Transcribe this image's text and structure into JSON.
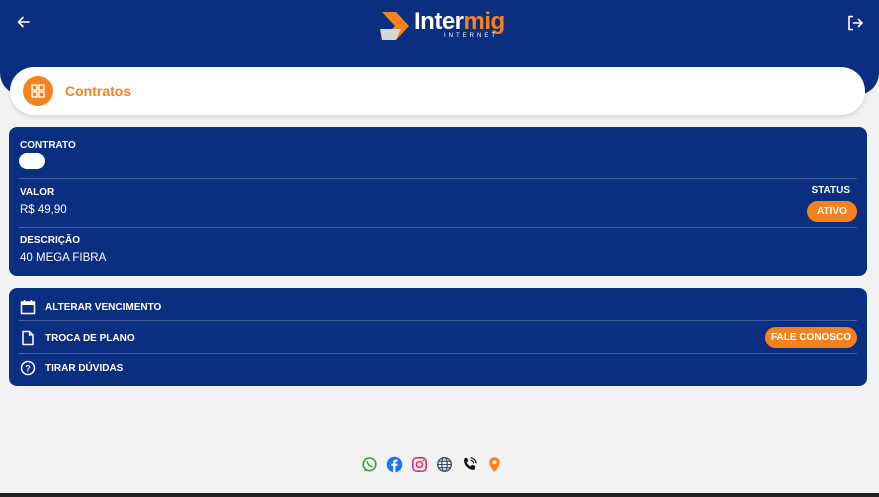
{
  "header": {
    "logo_main_white": "Inter",
    "logo_main_orange": "mig",
    "logo_sub": "INTERNET",
    "back_icon": "arrow-left-icon",
    "logout_icon": "logout-icon"
  },
  "title_card": {
    "icon": "grid-icon",
    "title": "Contratos"
  },
  "contract": {
    "contrato_label": "CONTRATO",
    "valor_label": "VALOR",
    "valor_value": "R$ 49,90",
    "status_label": "STATUS",
    "status_value": "ATIVO",
    "descricao_label": "DESCRIÇÃO",
    "descricao_value": "40 MEGA FIBRA"
  },
  "actions": {
    "items": [
      {
        "icon": "calendar-icon",
        "label": "ALTERAR VENCIMENTO"
      },
      {
        "icon": "document-icon",
        "label": "TROCA DE PLANO"
      },
      {
        "icon": "help-circle-icon",
        "label": "TIRAR DÚVIDAS"
      }
    ],
    "contact_button": "FALE CONOSCO"
  },
  "social": [
    "whatsapp-icon",
    "facebook-icon",
    "instagram-icon",
    "globe-icon",
    "phone-icon",
    "location-pin-icon"
  ],
  "colors": {
    "primary": "#0a2f80",
    "accent": "#f5821f",
    "background": "#f2f2f2",
    "whatsapp": "#25a244",
    "facebook": "#1877f2",
    "instagram": "#e1306c"
  }
}
